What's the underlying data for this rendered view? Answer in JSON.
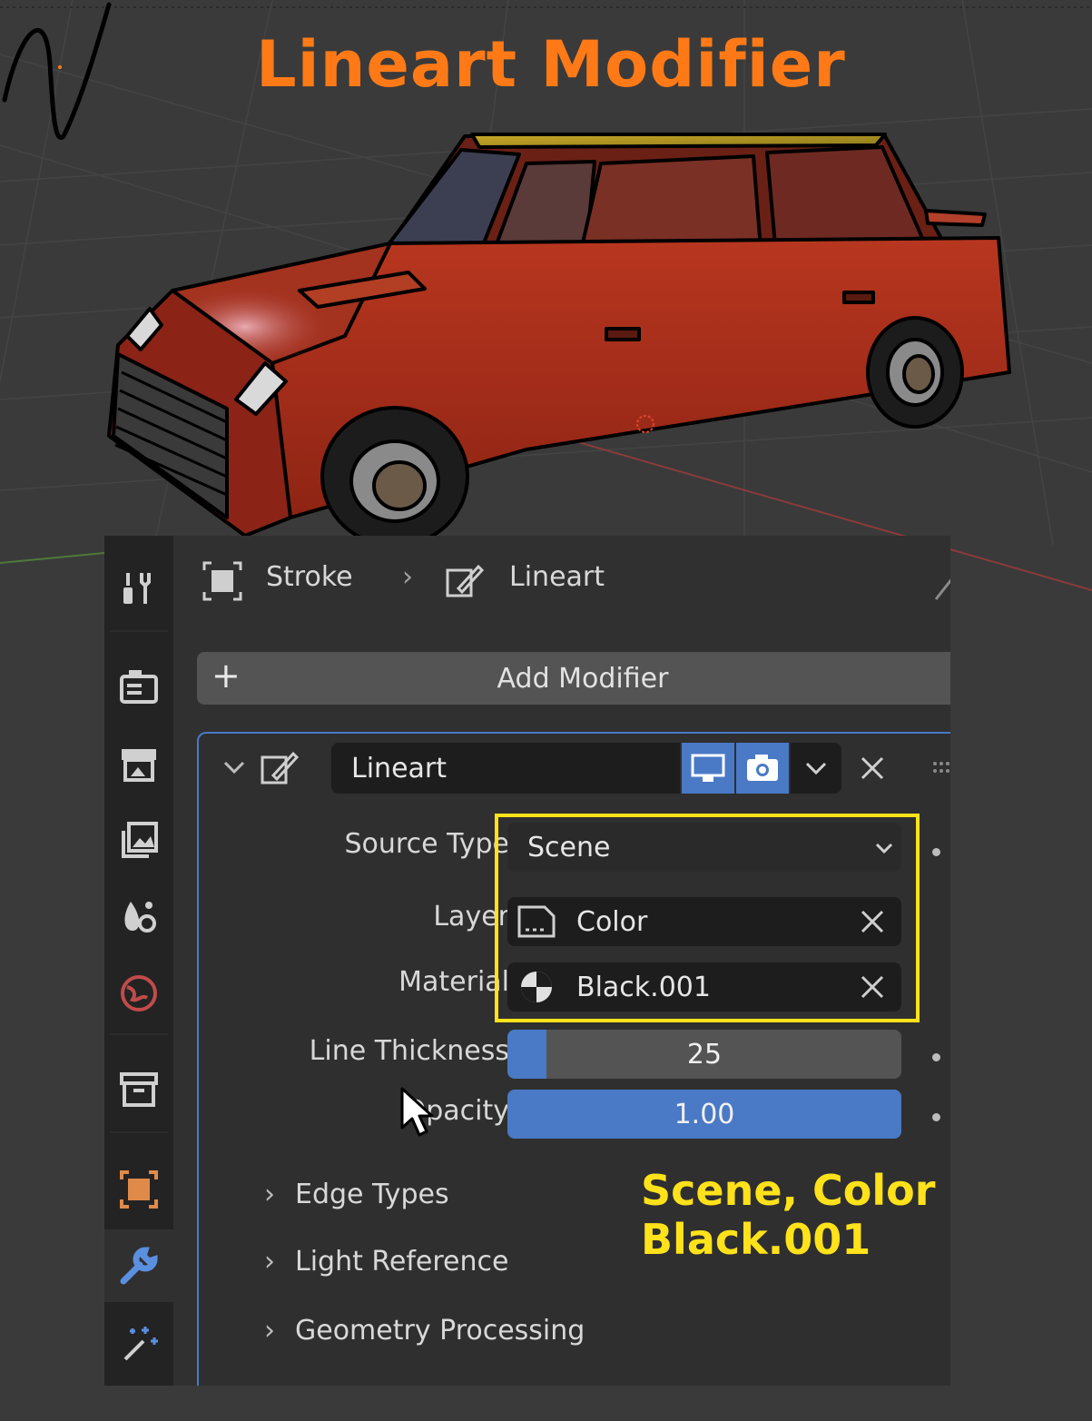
{
  "overlay": {
    "title": "Lineart Modifier",
    "annotation_line1": "Scene, Color",
    "annotation_line2": "Black.001"
  },
  "breadcrumb": {
    "object": "Stroke",
    "modifier": "Lineart"
  },
  "add_modifier_label": "Add Modifier",
  "modifier": {
    "name": "Lineart",
    "source_type_label": "Source Type",
    "source_type_value": "Scene",
    "layer_label": "Layer",
    "layer_value": "Color",
    "material_label": "Material",
    "material_value": "Black.001",
    "line_thickness_label": "Line Thickness",
    "line_thickness_value": "25",
    "line_thickness_fill": 0.1,
    "opacity_label": "Opacity",
    "opacity_value": "1.00",
    "opacity_fill": 1.0
  },
  "subpanels": [
    "Edge Types",
    "Light Reference",
    "Geometry Processing"
  ],
  "colors": {
    "title": "#ff7a17",
    "highlight": "#ffe21a",
    "accent": "#4a79c6",
    "car_body": "#a52a17"
  },
  "icons": [
    "tool-icon",
    "render-icon",
    "output-icon",
    "view-layer-icon",
    "scene-icon",
    "world-icon",
    "collection-icon",
    "object-icon",
    "modifier-wrench-icon",
    "effects-icon"
  ]
}
